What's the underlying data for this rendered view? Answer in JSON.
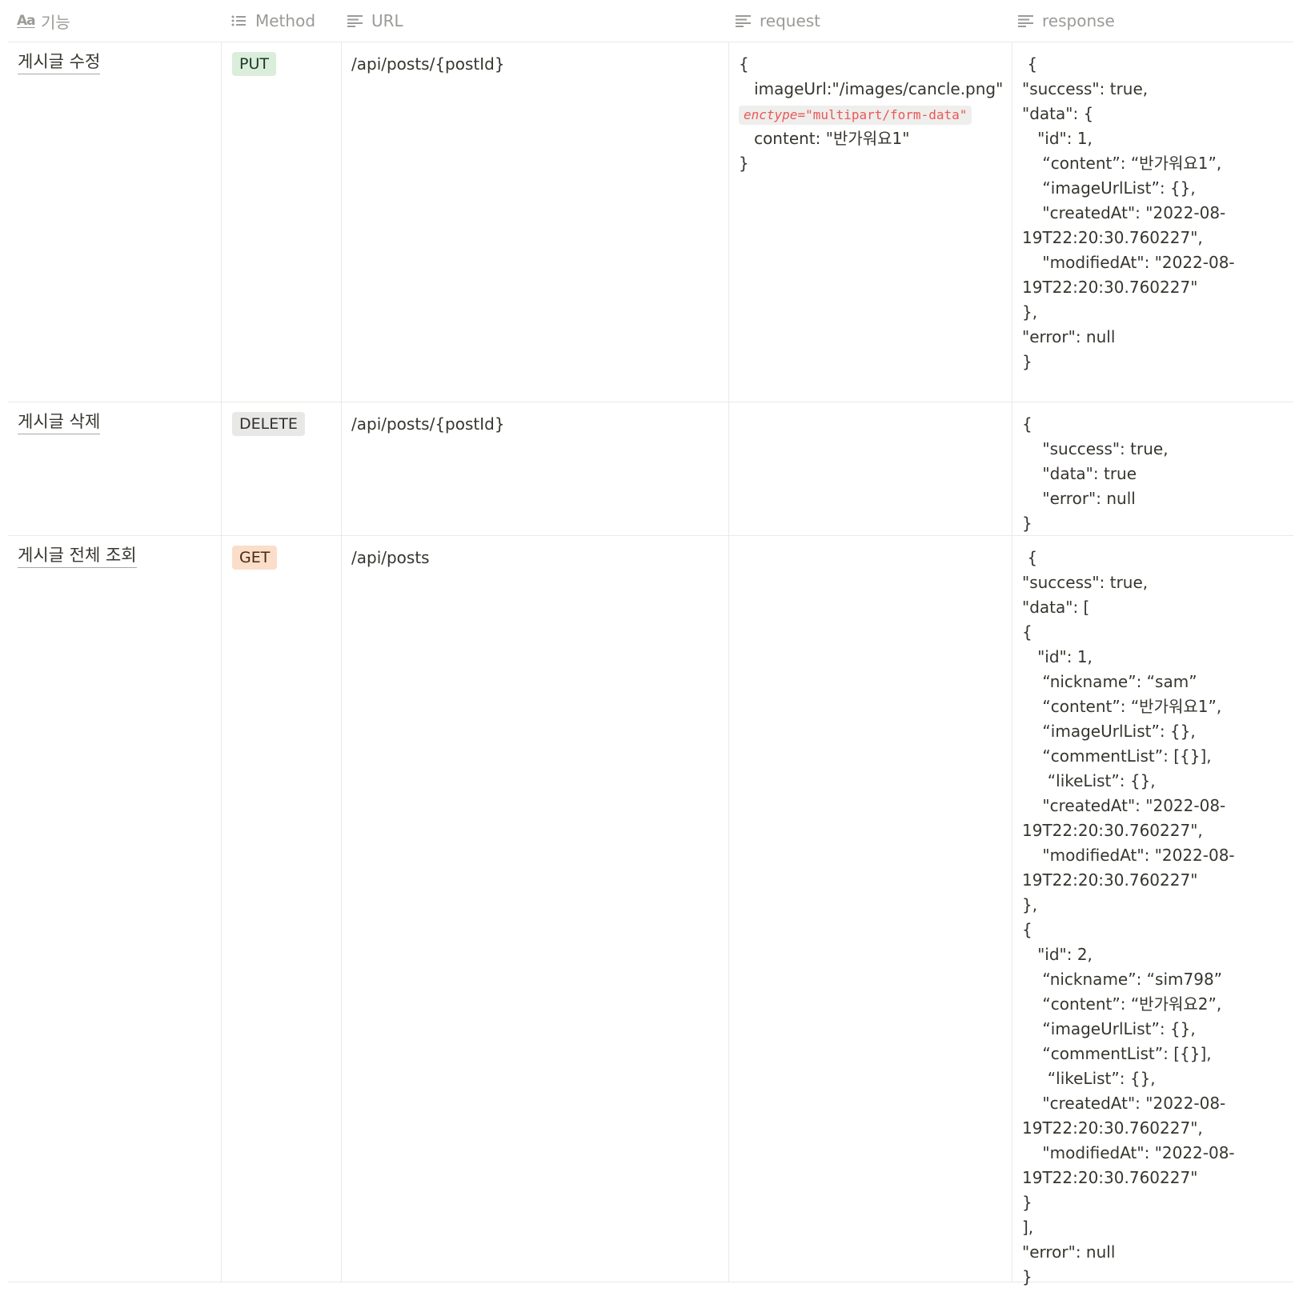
{
  "columns": [
    {
      "label": "기능",
      "icon": "title-aa-icon"
    },
    {
      "label": "Method",
      "icon": "list-icon"
    },
    {
      "label": "URL",
      "icon": "text-lines-icon"
    },
    {
      "label": "request",
      "icon": "text-lines-icon"
    },
    {
      "label": "response",
      "icon": "text-lines-icon"
    }
  ],
  "rows": [
    {
      "feature": "게시글 수정",
      "method": "PUT",
      "url": "/api/posts/{postId}",
      "request": {
        "open": "{",
        "line1": "   imageUrl:\"/images/cancle.png\"",
        "code_attr": "enctype",
        "code_value": "=\"multipart/form-data\"",
        "line3": "   content: \"반가워요1\"",
        "close": "}"
      },
      "response": [
        " {",
        "\"success\": true,",
        "\"data\": {",
        "   \"id\": 1,",
        "    “content”: “반가워요1”,",
        "    “imageUrlList”: {},",
        "    \"createdAt\": \"2022-08-",
        "19T22:20:30.760227\",",
        "    \"modifiedAt\": \"2022-08-",
        "19T22:20:30.760227\"",
        "},",
        "\"error\": null",
        "}"
      ]
    },
    {
      "feature": "게시글 삭제",
      "method": "DELETE",
      "url": "/api/posts/{postId}",
      "response": [
        "{",
        "    \"success\": true,",
        "    \"data\": true",
        "    \"error\": null",
        "}"
      ]
    },
    {
      "feature": "게시글 전체 조회",
      "method": "GET",
      "url": "/api/posts",
      "response": [
        " {",
        "\"success\": true,",
        "\"data\": [",
        "{",
        "   \"id\": 1,",
        "    “nickname”: “sam”",
        "    “content”: “반가워요1”,",
        "    “imageUrlList”: {},",
        "    “commentList”: [{}],",
        "     “likeList”: {},",
        "    \"createdAt\": \"2022-08-",
        "19T22:20:30.760227\",",
        "    \"modifiedAt\": \"2022-08-",
        "19T22:20:30.760227\"",
        "},",
        "{",
        "   \"id\": 2,",
        "    “nickname”: “sim798”",
        "    “content”: “반가워요2”,",
        "    “imageUrlList”: {},",
        "    “commentList”: [{}],",
        "     “likeList”: {},",
        "    \"createdAt\": \"2022-08-",
        "19T22:20:30.760227\",",
        "    \"modifiedAt\": \"2022-08-",
        "19T22:20:30.760227\"",
        "}",
        "],",
        "\"error\": null",
        "}"
      ]
    }
  ]
}
